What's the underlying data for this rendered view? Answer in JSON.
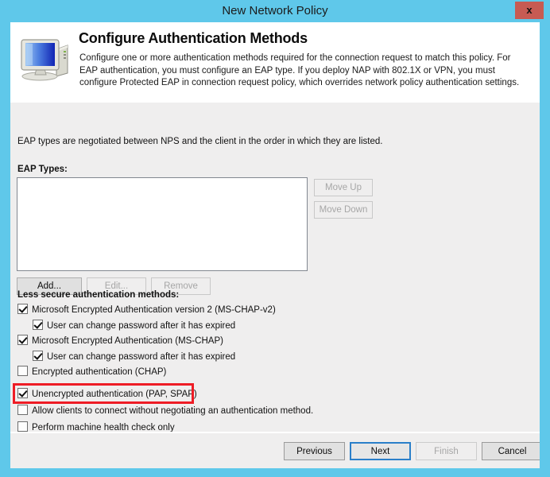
{
  "window": {
    "title": "New Network Policy",
    "close_label": "x",
    "accent_color": "#5fc8ea",
    "client_bg": "#efeeee",
    "highlight_color": "#ee1c25"
  },
  "header": {
    "icon": "computer-monitor-icon",
    "title": "Configure Authentication Methods",
    "description": "Configure one or more authentication methods required for the connection request to match this policy. For EAP authentication, you must configure an EAP type. If you deploy NAP with 802.1X or VPN, you must configure Protected EAP in connection request policy, which overrides network policy authentication settings."
  },
  "body": {
    "intro_text": "EAP types are negotiated between NPS and the client in the order in which they are listed.",
    "eap_types_label": "EAP Types:",
    "eap_types_items": [],
    "side_buttons": [
      {
        "label": "Move Up",
        "enabled": false
      },
      {
        "label": "Move Down",
        "enabled": false
      }
    ],
    "list_buttons": [
      {
        "label": "Add...",
        "enabled": true
      },
      {
        "label": "Edit...",
        "enabled": false
      },
      {
        "label": "Remove",
        "enabled": false
      }
    ],
    "less_secure_label": "Less secure authentication methods:",
    "checkboxes": [
      {
        "label": "Microsoft Encrypted Authentication version 2 (MS-CHAP-v2)",
        "checked": true,
        "indent": 0
      },
      {
        "label": "User can change password after it has expired",
        "checked": true,
        "indent": 1
      },
      {
        "label": "Microsoft Encrypted Authentication (MS-CHAP)",
        "checked": true,
        "indent": 0
      },
      {
        "label": "User can change password after it has expired",
        "checked": true,
        "indent": 1
      },
      {
        "label": "Encrypted authentication (CHAP)",
        "checked": false,
        "indent": 0
      },
      {
        "label": "Unencrypted authentication (PAP, SPAP)",
        "checked": true,
        "indent": 0,
        "highlighted": true
      },
      {
        "label": "Allow clients to connect without negotiating an authentication method.",
        "checked": false,
        "indent": 0
      },
      {
        "label": "Perform machine health check only",
        "checked": false,
        "indent": 0
      }
    ]
  },
  "footer": {
    "buttons": [
      {
        "label": "Previous",
        "enabled": true,
        "focused": false
      },
      {
        "label": "Next",
        "enabled": true,
        "focused": true
      },
      {
        "label": "Finish",
        "enabled": false,
        "focused": false
      },
      {
        "label": "Cancel",
        "enabled": true,
        "focused": false
      }
    ]
  }
}
